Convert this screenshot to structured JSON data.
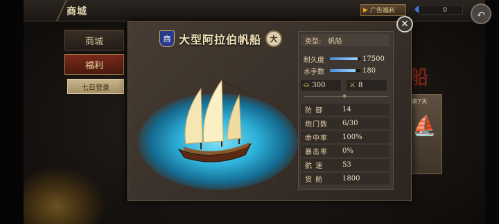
{
  "header": {
    "title": "商城",
    "ad_label": "广告福利",
    "gem_count": "0"
  },
  "menu": {
    "shop": "商城",
    "welfare": "福利",
    "seven_day": "七日登录"
  },
  "background": {
    "day_label": "第7天",
    "red_char": "船"
  },
  "ship": {
    "badge": "商",
    "name": "大型阿拉伯帆船",
    "size": "大",
    "type_label": "类型:",
    "type_value": "帆船",
    "durability_label": "耐久度",
    "durability_value": "17500",
    "durability_fill": 0.92,
    "crew_label": "水手数",
    "crew_value": "180",
    "crew_fill": 0.85,
    "cargo_icon_value": "300",
    "cannon_icon_value": "8",
    "stats": [
      {
        "label": "防 御",
        "value": "14"
      },
      {
        "label": "炮门数",
        "value": "6/30"
      },
      {
        "label": "命中率",
        "value": "100%"
      },
      {
        "label": "暴击率",
        "value": "0%"
      },
      {
        "label": "航 速",
        "value": "53"
      },
      {
        "label": "货 舱",
        "value": "1800"
      }
    ]
  },
  "colors": {
    "accent_gold": "#e2cfa8",
    "bar_blue": "#4a8bd8",
    "welfare_red": "#7a2a1a"
  },
  "icons": [
    "back-arrow-icon",
    "gem-icon",
    "play-icon",
    "close-icon",
    "gold-coins-icon",
    "crossed-swords-icon"
  ]
}
